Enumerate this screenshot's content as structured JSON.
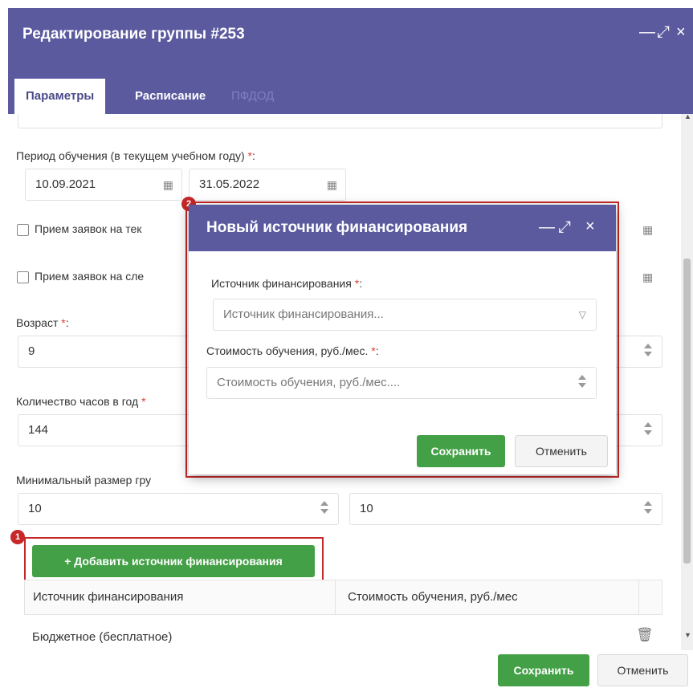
{
  "window": {
    "title": "Редактирование группы #253",
    "controls": {
      "minimize": "—",
      "maximize": "⤢",
      "close": "×"
    }
  },
  "tabs": [
    {
      "label": "Параметры",
      "state": "active"
    },
    {
      "label": "Расписание",
      "state": "normal"
    },
    {
      "label": "ПФДОД",
      "state": "disabled"
    }
  ],
  "form": {
    "period_label": "Период обучения (в текущем учебном году)",
    "period_suffix": ":",
    "required_mark": "*",
    "date_start": "10.09.2021",
    "date_end": "31.05.2022",
    "checkbox1_label": "Прием заявок на тек",
    "checkbox2_label": "Прием заявок на сле",
    "age_label": "Возраст",
    "age_value": "9",
    "hours_label": "Количество часов в год",
    "hours_value": "144",
    "min_size_label": "Минимальный размер гру",
    "min_size_value": "10",
    "max_size_value": "10",
    "add_button_label": "+ Добавить источник финансирования"
  },
  "table": {
    "columns": [
      "Источник финансирования",
      "Стоимость обучения, руб./мес"
    ],
    "rows": [
      {
        "source": "Бюджетное (бесплатное)",
        "cost": ""
      }
    ]
  },
  "footer": {
    "save_label": "Сохранить",
    "cancel_label": "Отменить"
  },
  "modal": {
    "title": "Новый источник финансирования",
    "source_label": "Источник финансирования",
    "source_placeholder": "Источник финансирования...",
    "cost_label": "Стоимость обучения, руб./мес.",
    "cost_placeholder": "Стоимость обучения, руб./мес....",
    "save_label": "Сохранить",
    "cancel_label": "Отменить"
  },
  "annotations": {
    "badge1": "1",
    "badge2": "2"
  },
  "colors": {
    "header": "#5b5a9f",
    "accent_green": "#44a047",
    "highlight_red": "#c62828",
    "required_red": "#e53935"
  }
}
